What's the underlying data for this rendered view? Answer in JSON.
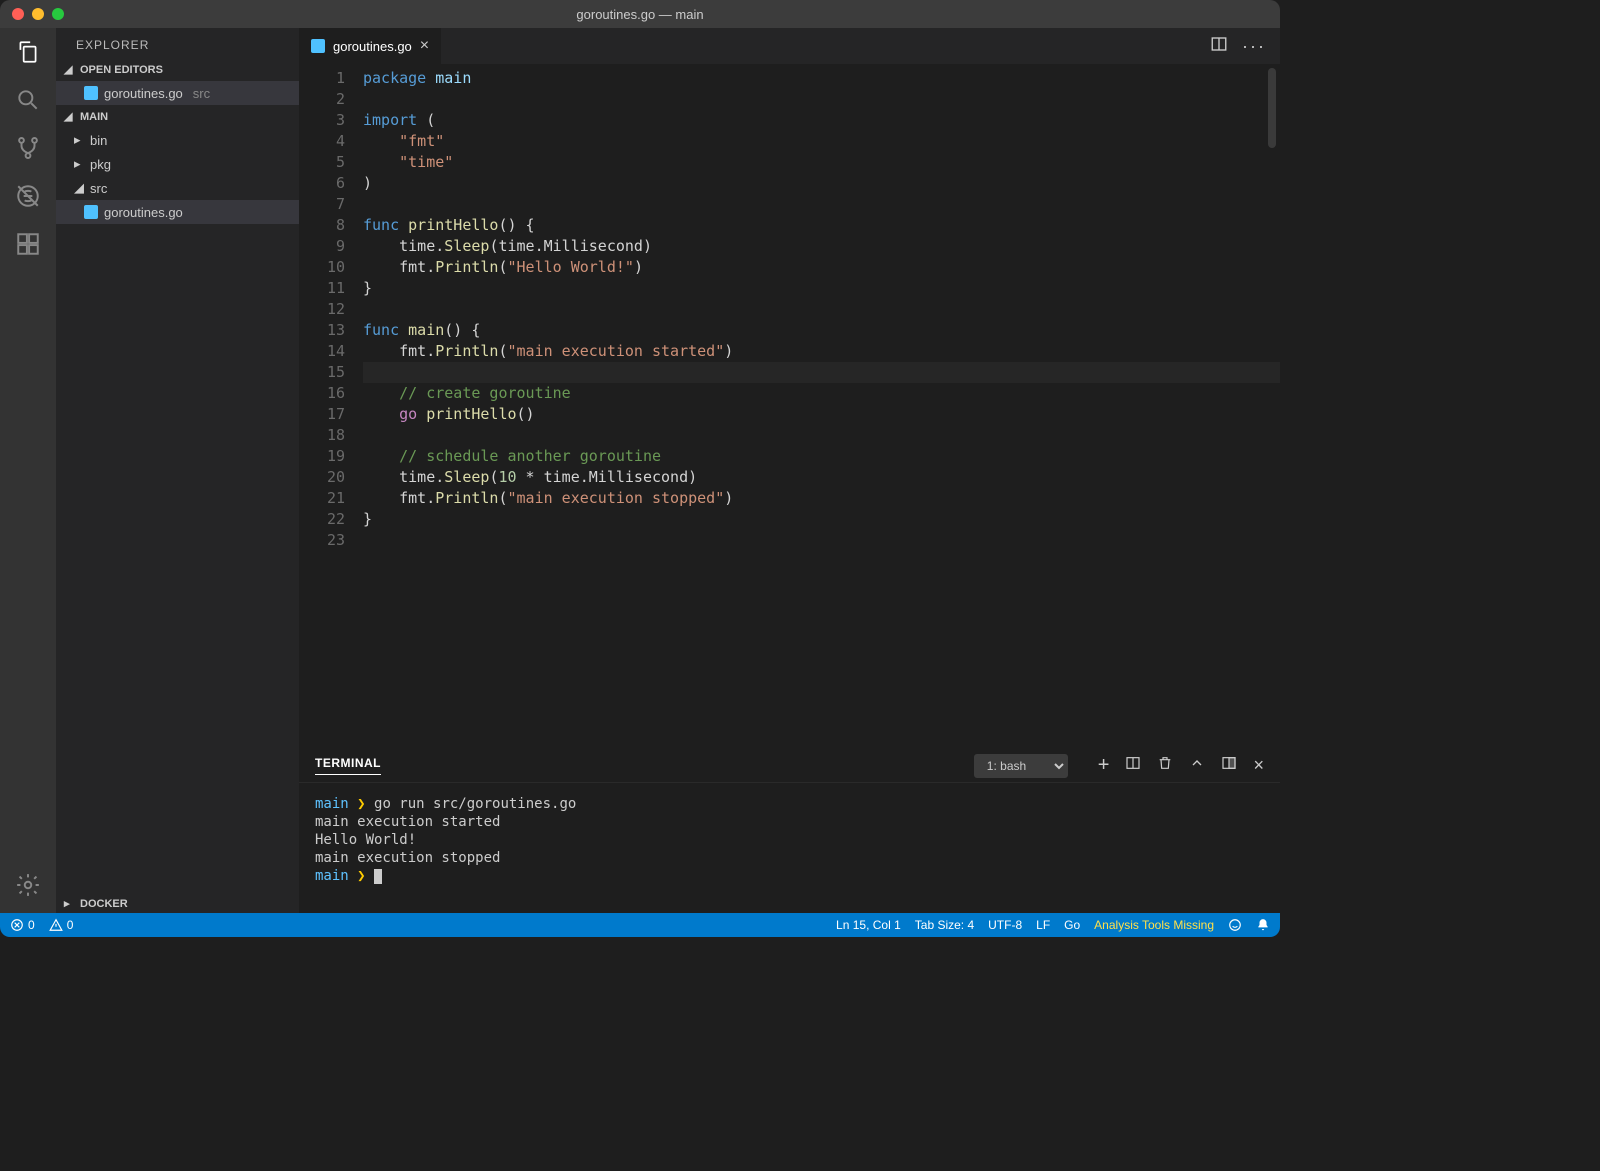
{
  "window": {
    "title": "goroutines.go — main"
  },
  "explorer": {
    "title": "EXPLORER",
    "open_editors_header": "OPEN EDITORS",
    "open_editors": [
      {
        "name": "goroutines.go",
        "hint": "src"
      }
    ],
    "workspace_header": "MAIN",
    "tree": {
      "bin": "bin",
      "pkg": "pkg",
      "src": "src",
      "src_children": [
        {
          "name": "goroutines.go"
        }
      ]
    },
    "bottom_section": "DOCKER"
  },
  "tabs": [
    {
      "label": "goroutines.go"
    }
  ],
  "editor": {
    "highlighted_line_index": 14,
    "lines": [
      [
        [
          "kw",
          "package"
        ],
        [
          "plain",
          " "
        ],
        [
          "id",
          "main"
        ]
      ],
      [],
      [
        [
          "kw",
          "import"
        ],
        [
          "plain",
          " ("
        ]
      ],
      [
        [
          "plain",
          "    "
        ],
        [
          "str",
          "\"fmt\""
        ]
      ],
      [
        [
          "plain",
          "    "
        ],
        [
          "str",
          "\"time\""
        ]
      ],
      [
        [
          "plain",
          ")"
        ]
      ],
      [],
      [
        [
          "kw",
          "func"
        ],
        [
          "plain",
          " "
        ],
        [
          "fn",
          "printHello"
        ],
        [
          "plain",
          "() {"
        ]
      ],
      [
        [
          "plain",
          "    time."
        ],
        [
          "fn",
          "Sleep"
        ],
        [
          "plain",
          "(time.Millisecond)"
        ]
      ],
      [
        [
          "plain",
          "    fmt."
        ],
        [
          "fn",
          "Println"
        ],
        [
          "plain",
          "("
        ],
        [
          "str",
          "\"Hello World!\""
        ],
        [
          "plain",
          ")"
        ]
      ],
      [
        [
          "plain",
          "}"
        ]
      ],
      [],
      [
        [
          "kw",
          "func"
        ],
        [
          "plain",
          " "
        ],
        [
          "fn",
          "main"
        ],
        [
          "plain",
          "() {"
        ]
      ],
      [
        [
          "plain",
          "    fmt."
        ],
        [
          "fn",
          "Println"
        ],
        [
          "plain",
          "("
        ],
        [
          "str",
          "\"main execution started\""
        ],
        [
          "plain",
          ")"
        ]
      ],
      [],
      [
        [
          "plain",
          "    "
        ],
        [
          "cmt",
          "// create goroutine"
        ]
      ],
      [
        [
          "plain",
          "    "
        ],
        [
          "ctrl",
          "go"
        ],
        [
          "plain",
          " "
        ],
        [
          "fn",
          "printHello"
        ],
        [
          "plain",
          "()"
        ]
      ],
      [],
      [
        [
          "plain",
          "    "
        ],
        [
          "cmt",
          "// schedule another goroutine"
        ]
      ],
      [
        [
          "plain",
          "    time."
        ],
        [
          "fn",
          "Sleep"
        ],
        [
          "plain",
          "("
        ],
        [
          "num",
          "10"
        ],
        [
          "plain",
          " * time.Millisecond)"
        ]
      ],
      [
        [
          "plain",
          "    fmt."
        ],
        [
          "fn",
          "Println"
        ],
        [
          "plain",
          "("
        ],
        [
          "str",
          "\"main execution stopped\""
        ],
        [
          "plain",
          ")"
        ]
      ],
      [
        [
          "plain",
          "}"
        ]
      ],
      []
    ]
  },
  "terminal": {
    "tab_label": "TERMINAL",
    "selector": "1: bash",
    "lines": [
      {
        "type": "prompt",
        "dir": "main",
        "cmd": "go run src/goroutines.go"
      },
      {
        "type": "out",
        "text": "main execution started"
      },
      {
        "type": "out",
        "text": "Hello World!"
      },
      {
        "type": "out",
        "text": "main execution stopped"
      },
      {
        "type": "prompt",
        "dir": "main",
        "cmd": ""
      }
    ]
  },
  "statusbar": {
    "errors": "0",
    "warnings": "0",
    "cursor": "Ln 15, Col 1",
    "indent": "Tab Size: 4",
    "encoding": "UTF-8",
    "eol": "LF",
    "language": "Go",
    "warn_msg": "Analysis Tools Missing"
  }
}
